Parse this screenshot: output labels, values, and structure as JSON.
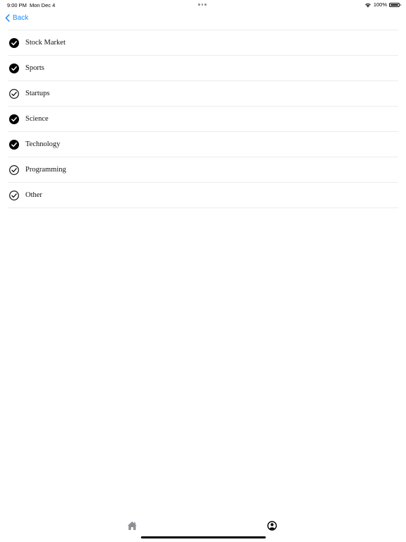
{
  "status_bar": {
    "time": "9:00 PM",
    "date": "Mon Dec 4",
    "battery": "100%",
    "wifi_icon": "wifi-icon",
    "battery_icon": "battery-full-icon"
  },
  "nav": {
    "back_label": "Back",
    "back_icon": "chevron-left-icon",
    "accent_color": "#1a8cff"
  },
  "topics": [
    {
      "label": "Stock Market",
      "selected": true
    },
    {
      "label": "Sports",
      "selected": true
    },
    {
      "label": "Startups",
      "selected": false
    },
    {
      "label": "Science",
      "selected": true
    },
    {
      "label": "Technology",
      "selected": true
    },
    {
      "label": "Programming",
      "selected": false
    },
    {
      "label": "Other",
      "selected": false
    }
  ],
  "tab_bar": {
    "home_icon": "home-icon",
    "profile_icon": "profile-icon",
    "selected_tab": "profile"
  }
}
